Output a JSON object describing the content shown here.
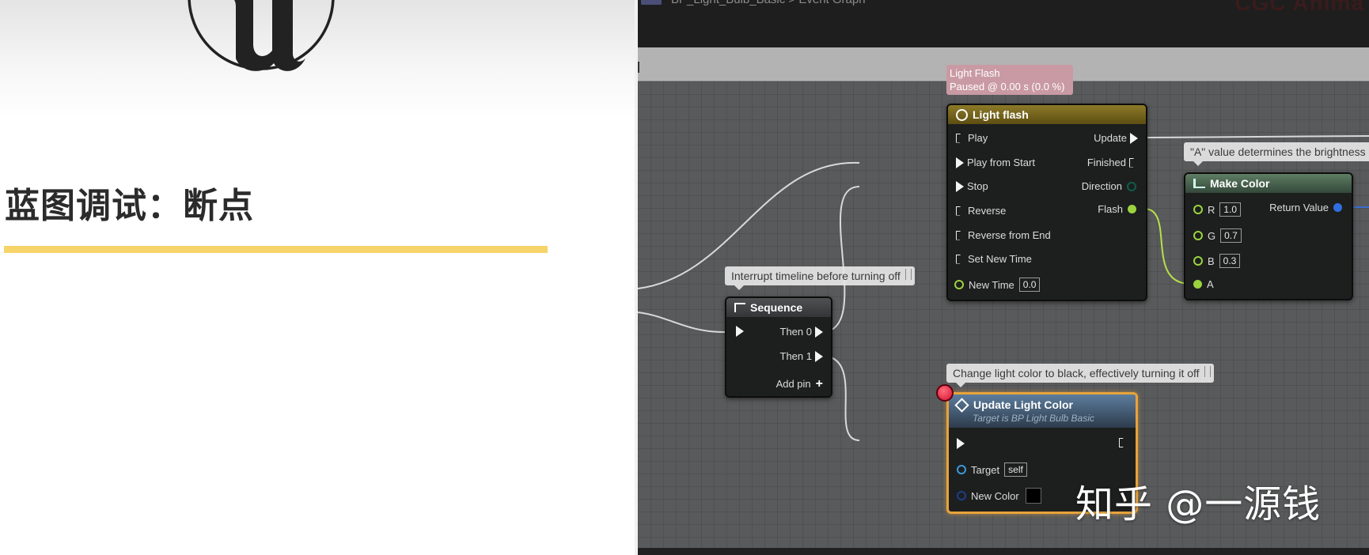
{
  "slide": {
    "title": "蓝图调试：断点",
    "underline_color": "#f7d46a",
    "logo_icon": "unreal-engine-logo"
  },
  "editor": {
    "breadcrumb": "BP_Light_Bulb_Basic > Event Graph",
    "corner_watermark": "CGC Anima"
  },
  "timeline_status": {
    "title": "Light Flash",
    "status": "Paused @ 0.00 s (0.0 %)"
  },
  "timeline_node": {
    "title": "Light flash",
    "icon": "clock-icon",
    "inputs": [
      "Play",
      "Play from Start",
      "Stop",
      "Reverse",
      "Reverse from End",
      "Set New Time"
    ],
    "new_time_label": "New Time",
    "new_time_value": "0.0",
    "outputs": [
      "Update",
      "Finished",
      "Direction",
      "Flash"
    ]
  },
  "make_color": {
    "comment": "\"A\" value determines the brightness",
    "title": "Make Color",
    "r_label": "R",
    "r_value": "1.0",
    "g_label": "G",
    "g_value": "0.7",
    "b_label": "B",
    "b_value": "0.3",
    "a_label": "A",
    "return_label": "Return Value"
  },
  "sequence": {
    "comment": "Interrupt timeline before turning off",
    "title": "Sequence",
    "then0": "Then 0",
    "then1": "Then 1",
    "add_pin": "Add pin"
  },
  "update_light_color": {
    "comment": "Change light color to black, effectively turning it off",
    "title": "Update Light Color",
    "subtitle": "Target is BP Light Bulb Basic",
    "target_label": "Target",
    "target_value": "self",
    "new_color_label": "New Color",
    "new_color_value": "#000000",
    "breakpoint": true
  },
  "watermark": "知乎 @一源钱"
}
